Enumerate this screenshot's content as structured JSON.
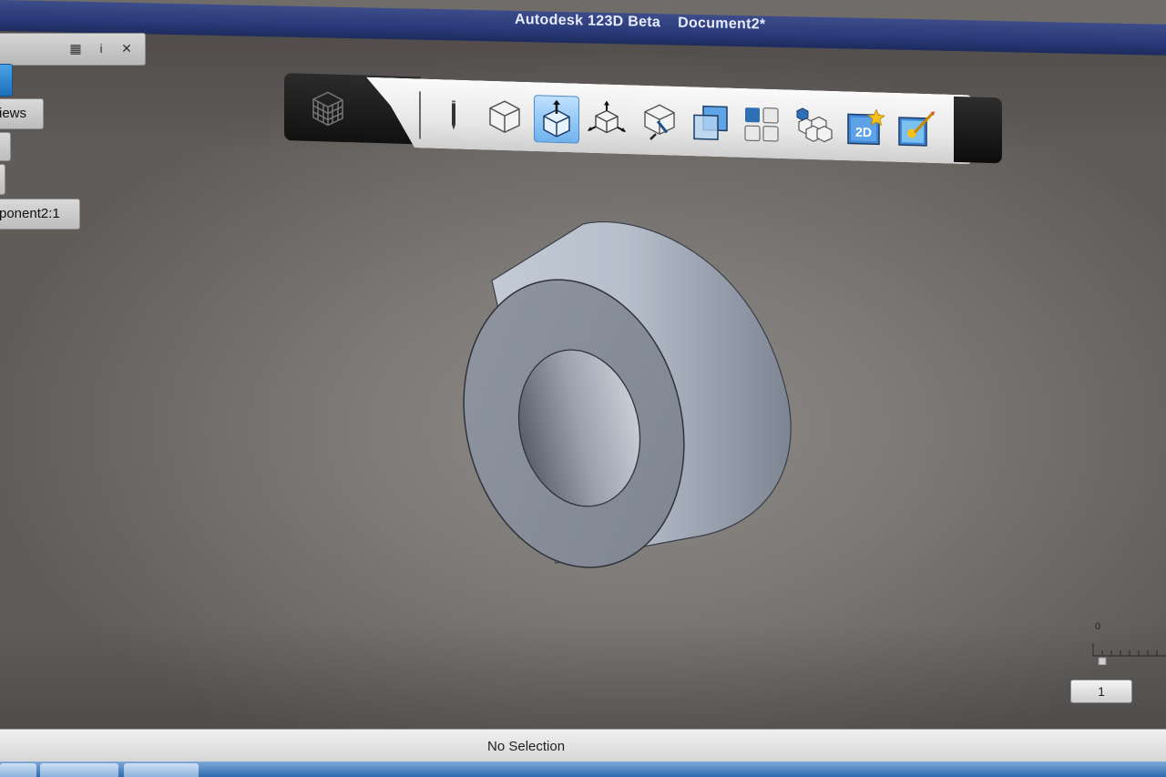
{
  "window": {
    "title": "Autodesk 123D Beta    Document2*"
  },
  "left_panel": {
    "views_label": "iews",
    "component_label": "ponent2:1"
  },
  "toolbar": {
    "buttons": [
      {
        "name": "sketch-icon"
      },
      {
        "name": "primitives-icon"
      },
      {
        "name": "construct-icon",
        "active": true
      },
      {
        "name": "modify-icon"
      },
      {
        "name": "pattern-icon"
      },
      {
        "name": "combine-icon"
      },
      {
        "name": "grid-icon"
      },
      {
        "name": "components-icon"
      },
      {
        "name": "2d-drawing-icon",
        "label": "2D"
      },
      {
        "name": "render-icon"
      }
    ]
  },
  "slider": {
    "min_label": "0",
    "value": "1"
  },
  "status": {
    "text": "No Selection"
  }
}
